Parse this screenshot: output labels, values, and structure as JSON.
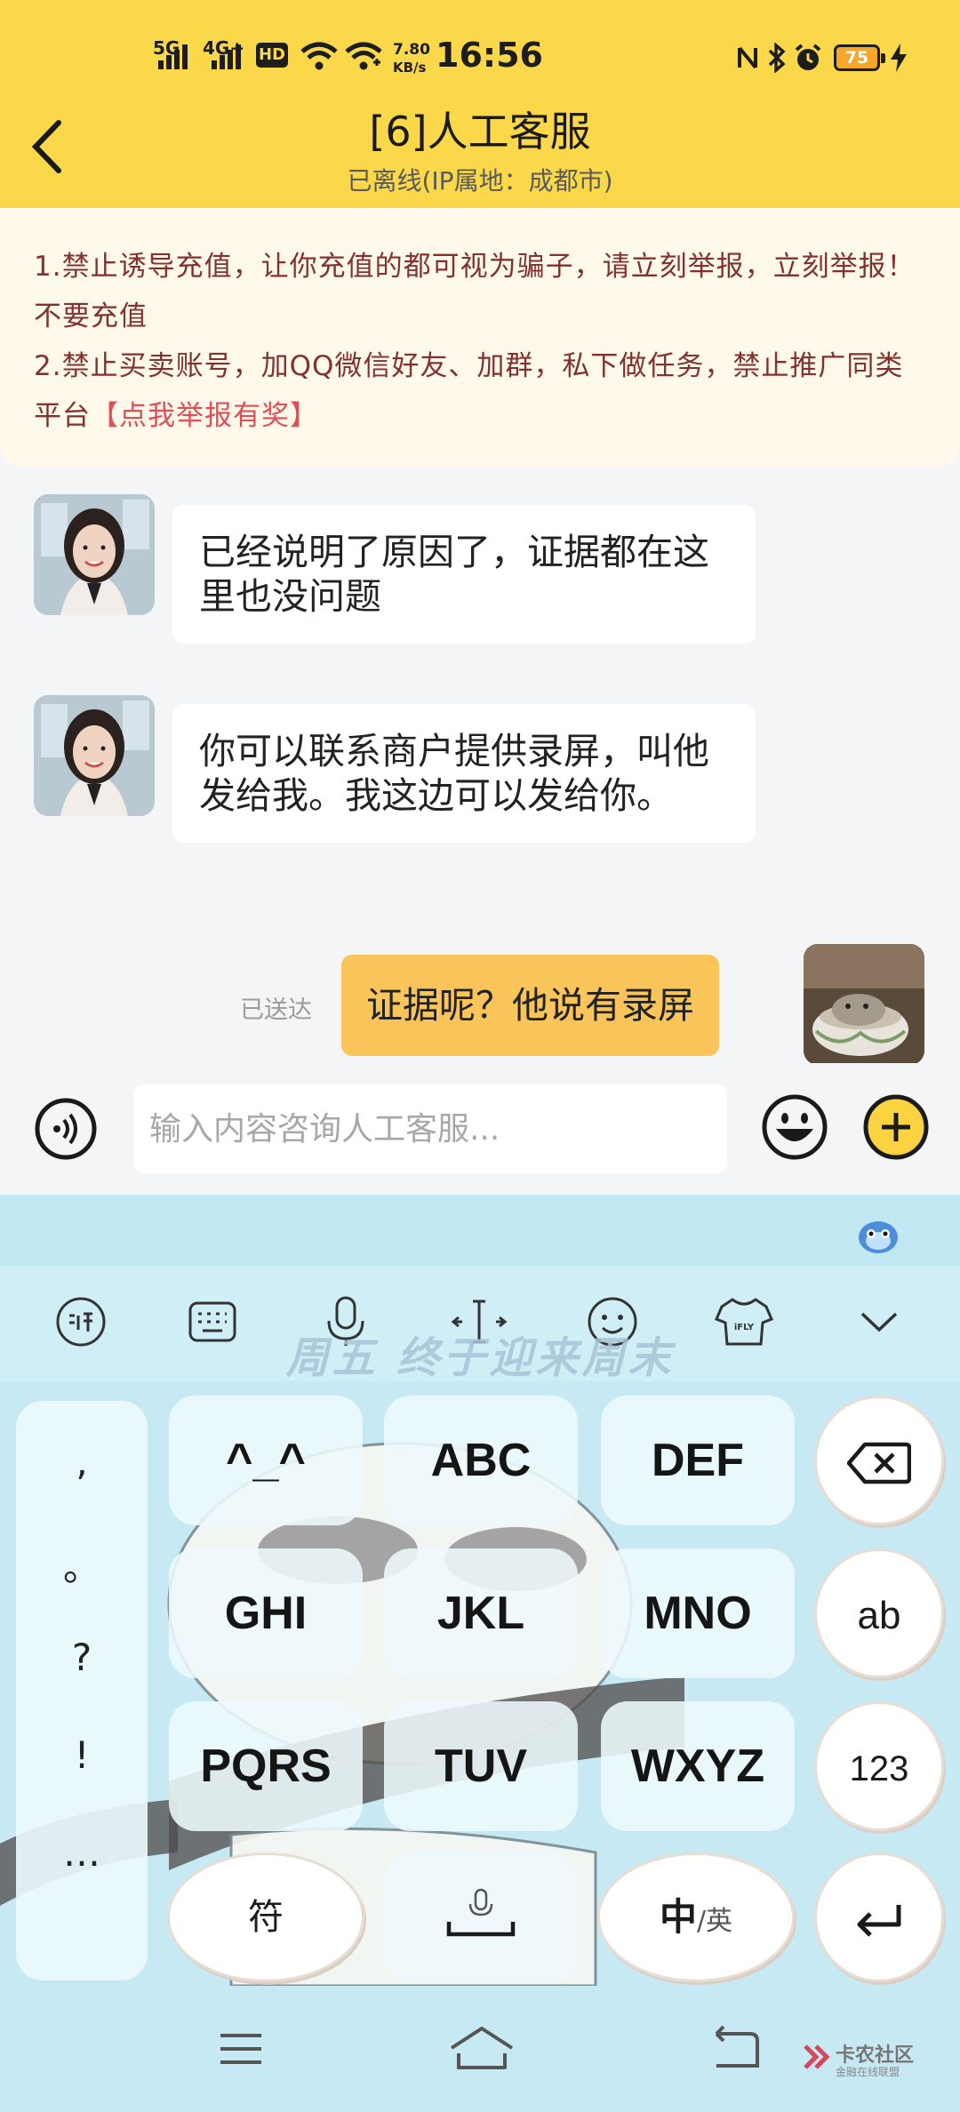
{
  "status_bar": {
    "network_1": "5G",
    "network_2": "4G+",
    "hd_badge": "HD",
    "speed_value": "7.80",
    "speed_unit": "KB/s",
    "time": "16:56",
    "battery": "75"
  },
  "header": {
    "title": "[6]人工客服",
    "subtitle": "已离线(IP属地：成都市)"
  },
  "notice": {
    "line1": "1.禁止诱导充值，让你充值的都可视为骗子，请立刻举报，立刻举报！ 不要充值",
    "line2_text": "2.禁止买卖账号，加QQ微信好友、加群，私下做任务，禁止推广同类平台",
    "line2_link": "【点我举报有奖】"
  },
  "messages": [
    {
      "from": "agent",
      "text": "已经说明了原因了，证据都在这里也没问题"
    },
    {
      "from": "agent",
      "text": "你可以联系商户提供录屏，叫他发给我。我这边可以发给你。"
    },
    {
      "from": "me",
      "text": "证据呢？他说有录屏",
      "status": "已送达"
    }
  ],
  "input": {
    "placeholder": "输入内容咨询人工客服..."
  },
  "keyboard": {
    "banner": "周五 终于迎来周末",
    "punctuation": [
      ",",
      "。",
      "?",
      "!",
      "…"
    ],
    "row1": [
      "^_^",
      "ABC",
      "DEF"
    ],
    "row2": [
      "GHI",
      "JKL",
      "MNO"
    ],
    "row3": [
      "PQRS",
      "TUV",
      "WXYZ"
    ],
    "side": {
      "ab": "ab",
      "num": "123"
    },
    "bottom": {
      "symbol": "符",
      "lang_main": "中",
      "lang_alt": "/英"
    },
    "toolbar_shirt_label": "iFLY"
  },
  "watermark": {
    "title": "卡农社区",
    "subtitle": "金融在线联盟"
  },
  "colors": {
    "header_bg": "#fad84a",
    "outgoing_bubble": "#f9c55a",
    "notice_text": "#82312e",
    "notice_link": "#e24e53",
    "keyboard_bg": "#c7e9f3"
  }
}
